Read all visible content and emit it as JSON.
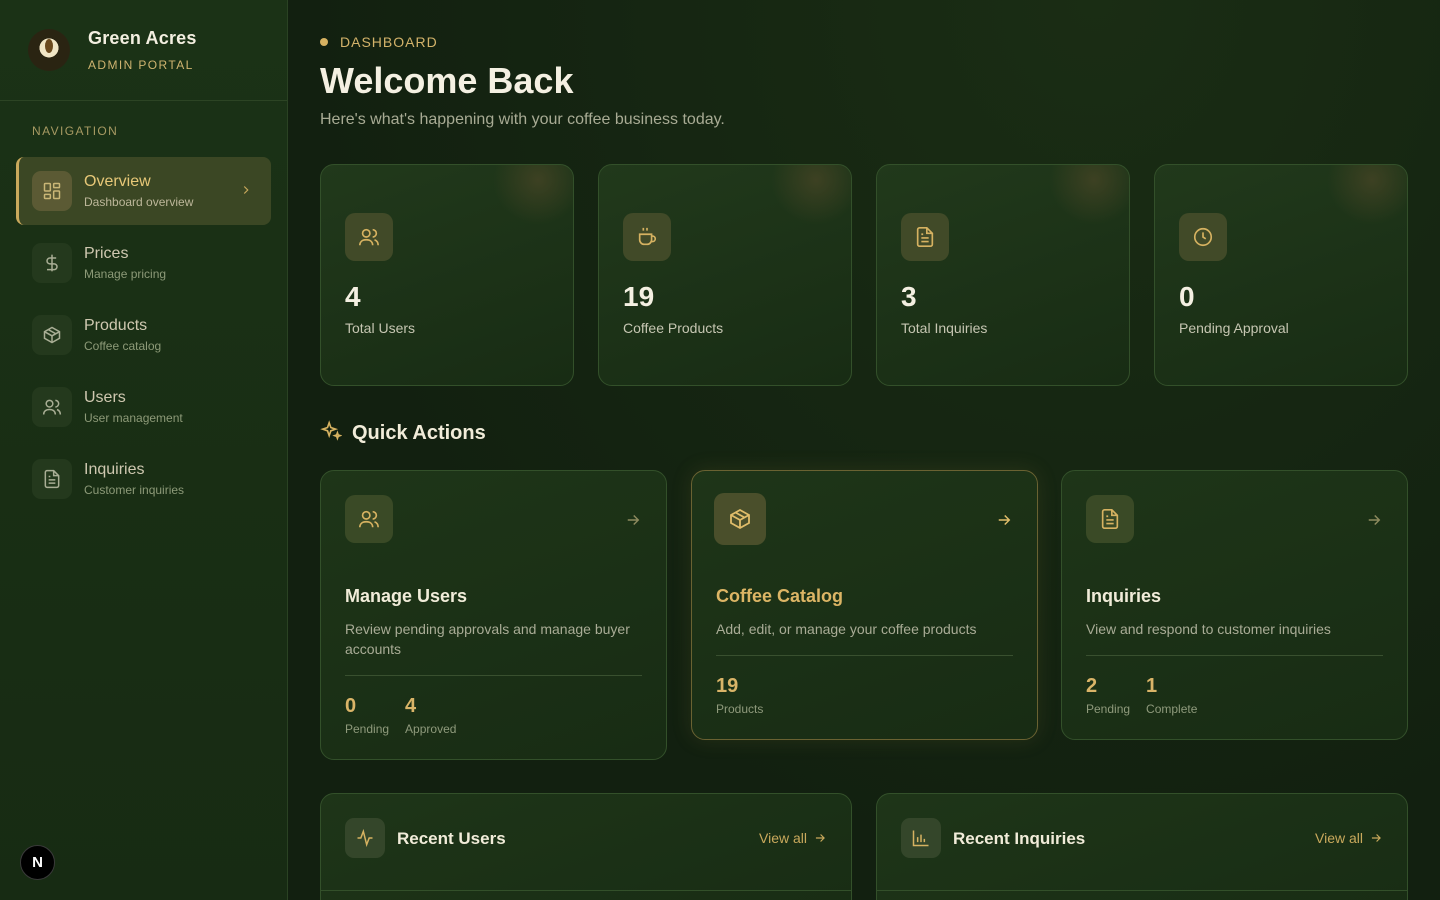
{
  "brand": {
    "name": "Green Acres",
    "subtitle": "ADMIN PORTAL"
  },
  "sidebar": {
    "heading": "NAVIGATION",
    "items": [
      {
        "label": "Overview",
        "desc": "Dashboard overview",
        "icon": "grid-icon",
        "active": true
      },
      {
        "label": "Prices",
        "desc": "Manage pricing",
        "icon": "dollar-icon"
      },
      {
        "label": "Products",
        "desc": "Coffee catalog",
        "icon": "package-icon"
      },
      {
        "label": "Users",
        "desc": "User management",
        "icon": "users-icon"
      },
      {
        "label": "Inquiries",
        "desc": "Customer inquiries",
        "icon": "document-icon"
      }
    ],
    "badge": "N"
  },
  "header": {
    "breadcrumb": "DASHBOARD",
    "title": "Welcome Back",
    "subtitle": "Here's what's happening with your coffee business today."
  },
  "stats": [
    {
      "value": "4",
      "label": "Total Users",
      "icon": "users-icon"
    },
    {
      "value": "19",
      "label": "Coffee Products",
      "icon": "coffee-cup-icon"
    },
    {
      "value": "3",
      "label": "Total Inquiries",
      "icon": "document-icon"
    },
    {
      "value": "0",
      "label": "Pending Approval",
      "icon": "clock-icon"
    }
  ],
  "quick_actions": {
    "title": "Quick Actions",
    "cards": [
      {
        "title": "Manage Users",
        "desc": "Review pending approvals and manage buyer accounts",
        "stats": [
          {
            "value": "0",
            "label": "Pending"
          },
          {
            "value": "4",
            "label": "Approved"
          }
        ]
      },
      {
        "title": "Coffee Catalog",
        "desc": "Add, edit, or manage your coffee products",
        "stats": [
          {
            "value": "19",
            "label": "Products"
          }
        ]
      },
      {
        "title": "Inquiries",
        "desc": "View and respond to customer inquiries",
        "stats": [
          {
            "value": "2",
            "label": "Pending"
          },
          {
            "value": "1",
            "label": "Complete"
          }
        ]
      }
    ]
  },
  "recent": [
    {
      "title": "Recent Users",
      "link": "View all",
      "icon": "activity-icon"
    },
    {
      "title": "Recent Inquiries",
      "link": "View all",
      "icon": "bar-chart-icon"
    }
  ],
  "colors": {
    "accent": "#d6b261",
    "background": "#13220f",
    "sidebar": "#1b3216"
  }
}
